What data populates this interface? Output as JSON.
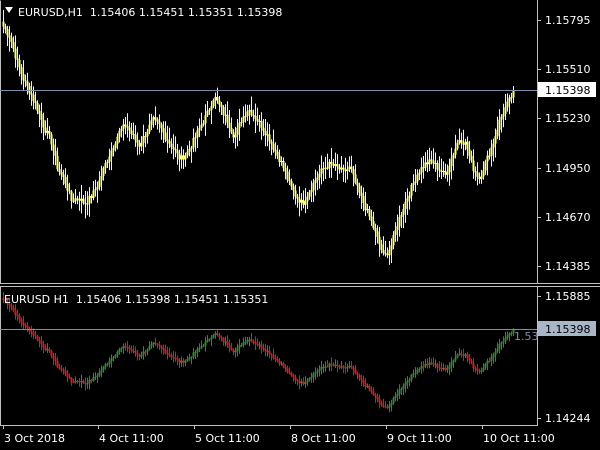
{
  "top_panel": {
    "header": "EURUSD,H1  1.15406 1.15451 1.15351 1.15398",
    "price_labels": [
      "1.15795",
      "1.15510",
      "1.15230",
      "1.14950",
      "1.14670",
      "1.14385"
    ],
    "current_price": "1.15398"
  },
  "bottom_panel": {
    "header": "EURUSD H1  1.15406 1.15398 1.15451 1.15351",
    "price_labels": [
      "1.15885",
      "1.14244"
    ],
    "current_price": "1.15398",
    "cut_label": "1.53"
  },
  "time_labels": [
    "3 Oct 2018",
    "4 Oct 11:00",
    "5 Oct 11:00",
    "8 Oct 11:00",
    "9 Oct 11:00",
    "10 Oct 11:00"
  ],
  "colors": {
    "bar_top": "#ffff80",
    "bull": "#2e8b2e",
    "bear": "#dc1a1a",
    "grid": "#c0c0c0",
    "price_line": "#7f8caa",
    "price_box": "#ffffff",
    "price_box_bottom": "#a9b6c7"
  },
  "icons": {
    "menu": "triangle-down-icon"
  },
  "chart_data": [
    {
      "type": "candlestick",
      "symbol": "EURUSD",
      "timeframe": "H1",
      "ylim": [
        1.1425,
        1.1586
      ],
      "x": [
        "3 Oct 2018",
        "4 Oct 11:00",
        "5 Oct 11:00",
        "8 Oct 11:00",
        "9 Oct 11:00",
        "10 Oct 11:00"
      ],
      "close_path": [
        1.1582,
        1.1575,
        1.156,
        1.1548,
        1.154,
        1.153,
        1.1518,
        1.151,
        1.1492,
        1.1485,
        1.1472,
        1.1474,
        1.147,
        1.1475,
        1.1483,
        1.1495,
        1.1505,
        1.1515,
        1.152,
        1.1513,
        1.1507,
        1.1515,
        1.1523,
        1.1519,
        1.1511,
        1.1505,
        1.1498,
        1.1502,
        1.151,
        1.1519,
        1.1527,
        1.1538,
        1.153,
        1.1522,
        1.1512,
        1.1523,
        1.153,
        1.1525,
        1.1519,
        1.1512,
        1.1503,
        1.1495,
        1.1483,
        1.1475,
        1.147,
        1.1478,
        1.1486,
        1.1492,
        1.1495,
        1.1493,
        1.149,
        1.1493,
        1.148,
        1.147,
        1.146,
        1.1448,
        1.1436,
        1.1443,
        1.1458,
        1.147,
        1.148,
        1.149,
        1.1495,
        1.1497,
        1.1492,
        1.1488,
        1.15,
        1.1511,
        1.1508,
        1.1493,
        1.1486,
        1.1497,
        1.1508,
        1.1523,
        1.1532,
        1.154
      ],
      "current": 1.15398
    }
  ]
}
